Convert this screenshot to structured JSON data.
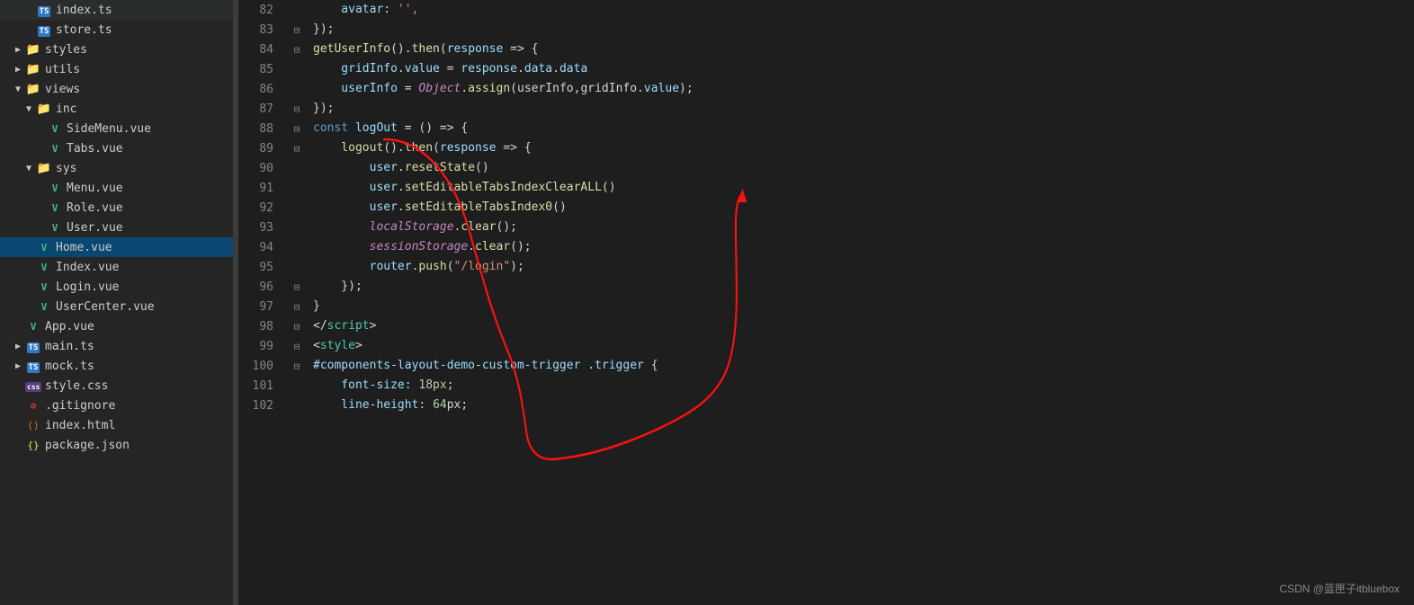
{
  "sidebar": {
    "items": [
      {
        "id": "index-ts",
        "label": "index.ts",
        "type": "ts",
        "indent": 2,
        "arrow": "",
        "selected": false
      },
      {
        "id": "store-ts",
        "label": "store.ts",
        "type": "ts",
        "indent": 2,
        "arrow": "",
        "selected": false
      },
      {
        "id": "styles",
        "label": "styles",
        "type": "folder",
        "indent": 1,
        "arrow": "▶",
        "selected": false
      },
      {
        "id": "utils",
        "label": "utils",
        "type": "folder",
        "indent": 1,
        "arrow": "▶",
        "selected": false
      },
      {
        "id": "views",
        "label": "views",
        "type": "folder-open",
        "indent": 1,
        "arrow": "▼",
        "selected": false
      },
      {
        "id": "inc",
        "label": "inc",
        "type": "folder-open",
        "indent": 2,
        "arrow": "▼",
        "selected": false
      },
      {
        "id": "sidemenu-vue",
        "label": "SideMenu.vue",
        "type": "vue",
        "indent": 3,
        "arrow": "",
        "selected": false
      },
      {
        "id": "tabs-vue",
        "label": "Tabs.vue",
        "type": "vue",
        "indent": 3,
        "arrow": "",
        "selected": false
      },
      {
        "id": "sys",
        "label": "sys",
        "type": "folder-open",
        "indent": 2,
        "arrow": "▼",
        "selected": false
      },
      {
        "id": "menu-vue",
        "label": "Menu.vue",
        "type": "vue",
        "indent": 3,
        "arrow": "",
        "selected": false
      },
      {
        "id": "role-vue",
        "label": "Role.vue",
        "type": "vue",
        "indent": 3,
        "arrow": "",
        "selected": false
      },
      {
        "id": "user-vue",
        "label": "User.vue",
        "type": "vue",
        "indent": 3,
        "arrow": "",
        "selected": false
      },
      {
        "id": "home-vue",
        "label": "Home.vue",
        "type": "vue",
        "indent": 2,
        "arrow": "",
        "selected": true
      },
      {
        "id": "index-vue",
        "label": "Index.vue",
        "type": "vue",
        "indent": 2,
        "arrow": "",
        "selected": false
      },
      {
        "id": "login-vue",
        "label": "Login.vue",
        "type": "vue",
        "indent": 2,
        "arrow": "",
        "selected": false
      },
      {
        "id": "usercenter-vue",
        "label": "UserCenter.vue",
        "type": "vue",
        "indent": 2,
        "arrow": "",
        "selected": false
      },
      {
        "id": "app-vue",
        "label": "App.vue",
        "type": "vue",
        "indent": 1,
        "arrow": "",
        "selected": false
      },
      {
        "id": "main-ts",
        "label": "main.ts",
        "type": "ts",
        "indent": 1,
        "arrow": "▶",
        "selected": false
      },
      {
        "id": "mock-ts",
        "label": "mock.ts",
        "type": "ts",
        "indent": 1,
        "arrow": "▶",
        "selected": false
      },
      {
        "id": "style-css",
        "label": "style.css",
        "type": "css",
        "indent": 1,
        "arrow": "",
        "selected": false
      },
      {
        "id": "gitignore",
        "label": ".gitignore",
        "type": "git",
        "indent": 1,
        "arrow": "",
        "selected": false
      },
      {
        "id": "index-html",
        "label": "index.html",
        "type": "html",
        "indent": 1,
        "arrow": "",
        "selected": false
      },
      {
        "id": "package-json",
        "label": "package.json",
        "type": "json",
        "indent": 1,
        "arrow": "",
        "selected": false
      }
    ]
  },
  "editor": {
    "lines": [
      {
        "num": 82,
        "gutter": "",
        "content": [
          {
            "text": "    avatar: ",
            "cls": "prop"
          },
          {
            "text": "'',",
            "cls": "str"
          }
        ]
      },
      {
        "num": 83,
        "gutter": "⊟",
        "content": [
          {
            "text": "});",
            "cls": "punct"
          }
        ]
      },
      {
        "num": 84,
        "gutter": "⊟",
        "content": [
          {
            "text": "getUserInfo",
            "cls": "fn"
          },
          {
            "text": "().",
            "cls": "punct"
          },
          {
            "text": "then",
            "cls": "fn"
          },
          {
            "text": "(",
            "cls": "punct"
          },
          {
            "text": "response",
            "cls": "var"
          },
          {
            "text": " => {",
            "cls": "punct"
          }
        ]
      },
      {
        "num": 85,
        "gutter": "",
        "content": [
          {
            "text": "    gridInfo",
            "cls": "var"
          },
          {
            "text": ".",
            "cls": "punct"
          },
          {
            "text": "value",
            "cls": "prop"
          },
          {
            "text": " = ",
            "cls": "op"
          },
          {
            "text": "response",
            "cls": "var"
          },
          {
            "text": ".",
            "cls": "punct"
          },
          {
            "text": "data",
            "cls": "prop"
          },
          {
            "text": ".",
            "cls": "punct"
          },
          {
            "text": "data",
            "cls": "prop"
          }
        ]
      },
      {
        "num": 86,
        "gutter": "",
        "content": [
          {
            "text": "    userInfo",
            "cls": "var"
          },
          {
            "text": " = ",
            "cls": "op"
          },
          {
            "text": "Object",
            "cls": "italic-kw italic"
          },
          {
            "text": ".",
            "cls": "punct"
          },
          {
            "text": "assign",
            "cls": "fn"
          },
          {
            "text": "(userInfo,gridInfo.",
            "cls": "punct"
          },
          {
            "text": "value",
            "cls": "prop"
          },
          {
            "text": ");",
            "cls": "punct"
          }
        ]
      },
      {
        "num": 87,
        "gutter": "⊟",
        "content": [
          {
            "text": "});",
            "cls": "punct"
          }
        ]
      },
      {
        "num": 88,
        "gutter": "⊟",
        "content": [
          {
            "text": "const",
            "cls": "kw"
          },
          {
            "text": " logOut",
            "cls": "var"
          },
          {
            "text": " = () => {",
            "cls": "punct"
          }
        ]
      },
      {
        "num": 89,
        "gutter": "⊟",
        "content": [
          {
            "text": "    logout",
            "cls": "fn"
          },
          {
            "text": "().",
            "cls": "punct"
          },
          {
            "text": "then",
            "cls": "fn"
          },
          {
            "text": "(",
            "cls": "punct"
          },
          {
            "text": "response",
            "cls": "var"
          },
          {
            "text": " => {",
            "cls": "punct"
          }
        ]
      },
      {
        "num": 90,
        "gutter": "",
        "content": [
          {
            "text": "        user",
            "cls": "var"
          },
          {
            "text": ".",
            "cls": "punct"
          },
          {
            "text": "resetState",
            "cls": "fn"
          },
          {
            "text": "()",
            "cls": "punct"
          }
        ]
      },
      {
        "num": 91,
        "gutter": "",
        "content": [
          {
            "text": "        user",
            "cls": "var"
          },
          {
            "text": ".",
            "cls": "punct"
          },
          {
            "text": "setEditableTabsIndexClearALL",
            "cls": "fn"
          },
          {
            "text": "()",
            "cls": "punct"
          }
        ]
      },
      {
        "num": 92,
        "gutter": "",
        "content": [
          {
            "text": "        user",
            "cls": "var"
          },
          {
            "text": ".",
            "cls": "punct"
          },
          {
            "text": "setEditableTabsIndex0",
            "cls": "fn"
          },
          {
            "text": "()",
            "cls": "punct"
          }
        ]
      },
      {
        "num": 93,
        "gutter": "",
        "content": [
          {
            "text": "        localStorage",
            "cls": "italic italic-kw"
          },
          {
            "text": ".",
            "cls": "punct"
          },
          {
            "text": "clear",
            "cls": "fn"
          },
          {
            "text": "();",
            "cls": "punct"
          }
        ]
      },
      {
        "num": 94,
        "gutter": "",
        "content": [
          {
            "text": "        sessionStorage",
            "cls": "italic italic-kw"
          },
          {
            "text": ".",
            "cls": "punct"
          },
          {
            "text": "clear",
            "cls": "fn"
          },
          {
            "text": "();",
            "cls": "punct"
          }
        ]
      },
      {
        "num": 95,
        "gutter": "",
        "content": [
          {
            "text": "        router",
            "cls": "var"
          },
          {
            "text": ".",
            "cls": "punct"
          },
          {
            "text": "push",
            "cls": "fn"
          },
          {
            "text": "(",
            "cls": "punct"
          },
          {
            "text": "\"/login\"",
            "cls": "str"
          },
          {
            "text": ");",
            "cls": "punct"
          }
        ]
      },
      {
        "num": 96,
        "gutter": "⊟",
        "content": [
          {
            "text": "    });",
            "cls": "punct"
          }
        ]
      },
      {
        "num": 97,
        "gutter": "⊟",
        "content": [
          {
            "text": "}",
            "cls": "punct"
          }
        ]
      },
      {
        "num": 98,
        "gutter": "⊟",
        "content": [
          {
            "text": "</",
            "cls": "punct"
          },
          {
            "text": "script",
            "cls": "tag"
          },
          {
            "text": ">",
            "cls": "punct"
          }
        ]
      },
      {
        "num": 99,
        "gutter": "⊟",
        "content": [
          {
            "text": "<",
            "cls": "punct"
          },
          {
            "text": "style",
            "cls": "tag"
          },
          {
            "text": ">",
            "cls": "punct"
          }
        ]
      },
      {
        "num": 100,
        "gutter": "⊟",
        "content": [
          {
            "text": "#components-layout-demo-custom-trigger ",
            "cls": "prop"
          },
          {
            "text": ".trigger",
            "cls": "attr"
          },
          {
            "text": " {",
            "cls": "punct"
          }
        ]
      },
      {
        "num": 101,
        "gutter": "",
        "content": [
          {
            "text": "    font-size: ",
            "cls": "prop"
          },
          {
            "text": "18px",
            "cls": "num"
          },
          {
            "text": ";",
            "cls": "punct"
          }
        ]
      },
      {
        "num": 102,
        "gutter": "",
        "content": [
          {
            "text": "    line-height: ",
            "cls": "prop"
          },
          {
            "text": "64",
            "cls": "num"
          },
          {
            "text": "px",
            "cls": "punct"
          },
          {
            "text": ";",
            "cls": "punct"
          }
        ]
      }
    ]
  },
  "watermark": "CSDN @蓝匣子itbluebox"
}
